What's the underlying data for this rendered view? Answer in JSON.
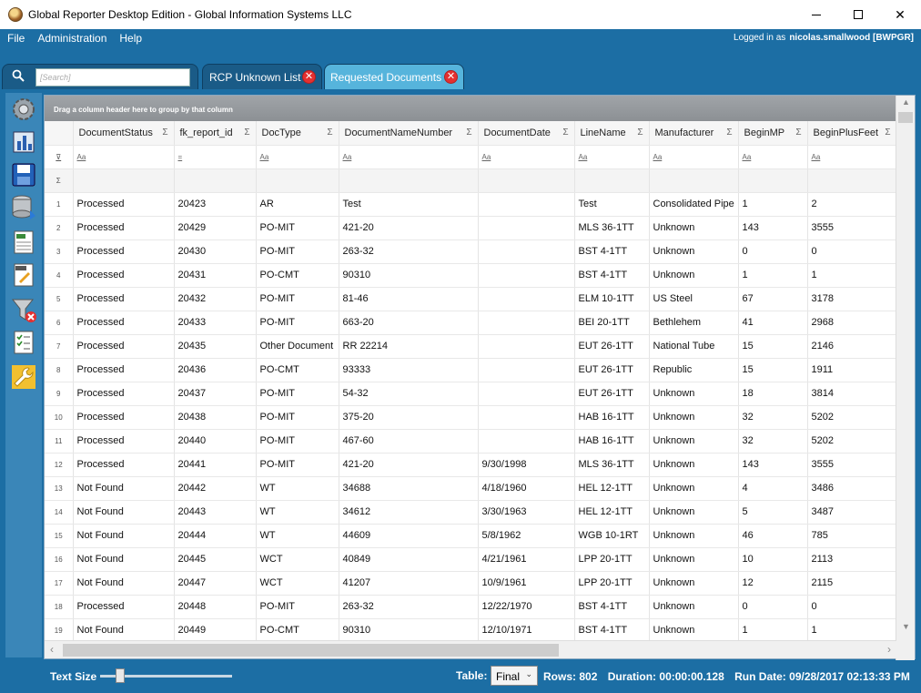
{
  "window": {
    "title": "Global Reporter Desktop Edition - Global Information Systems LLC"
  },
  "menu": {
    "items": [
      "File",
      "Administration",
      "Help"
    ],
    "logged_in_label": "Logged in as",
    "user": "nicolas.smallwood [BWPGR]"
  },
  "tabs": {
    "search_placeholder": "[Search]",
    "items": [
      {
        "label": "RCP Unknown List"
      },
      {
        "label": "Requested Documents"
      }
    ]
  },
  "grid": {
    "group_hint": "Drag a column header here to group by that column",
    "columns": [
      "DocumentStatus",
      "fk_report_id",
      "DocType",
      "DocumentNameNumber",
      "DocumentDate",
      "LineName",
      "Manufacturer",
      "BeginMP",
      "BeginPlusFeet"
    ],
    "filter_ops": [
      "Aa",
      "=",
      "Aa",
      "Aa",
      "Aa",
      "Aa",
      "Aa",
      "Aa",
      "Aa"
    ],
    "rows": [
      [
        "1",
        "Processed",
        "20423",
        "AR",
        "Test",
        "",
        "Test",
        "Consolidated Pipe",
        "1",
        "2"
      ],
      [
        "2",
        "Processed",
        "20429",
        "PO-MIT",
        "421-20",
        "",
        "MLS 36-1TT",
        "Unknown",
        "143",
        "3555"
      ],
      [
        "3",
        "Processed",
        "20430",
        "PO-MIT",
        "263-32",
        "",
        "BST 4-1TT",
        "Unknown",
        "0",
        "0"
      ],
      [
        "4",
        "Processed",
        "20431",
        "PO-CMT",
        "90310",
        "",
        "BST 4-1TT",
        "Unknown",
        "1",
        "1"
      ],
      [
        "5",
        "Processed",
        "20432",
        "PO-MIT",
        "81-46",
        "",
        "ELM 10-1TT",
        "US Steel",
        "67",
        "3178"
      ],
      [
        "6",
        "Processed",
        "20433",
        "PO-MIT",
        "663-20",
        "",
        "BEI 20-1TT",
        "Bethlehem",
        "41",
        "2968"
      ],
      [
        "7",
        "Processed",
        "20435",
        "Other Document",
        "RR 22214",
        "",
        "EUT 26-1TT",
        "National Tube",
        "15",
        "2146"
      ],
      [
        "8",
        "Processed",
        "20436",
        "PO-CMT",
        "93333",
        "",
        "EUT 26-1TT",
        "Republic",
        "15",
        "1911"
      ],
      [
        "9",
        "Processed",
        "20437",
        "PO-MIT",
        "54-32",
        "",
        "EUT 26-1TT",
        "Unknown",
        "18",
        "3814"
      ],
      [
        "10",
        "Processed",
        "20438",
        "PO-MIT",
        "375-20",
        "",
        "HAB 16-1TT",
        "Unknown",
        "32",
        "5202"
      ],
      [
        "11",
        "Processed",
        "20440",
        "PO-MIT",
        "467-60",
        "",
        "HAB 16-1TT",
        "Unknown",
        "32",
        "5202"
      ],
      [
        "12",
        "Processed",
        "20441",
        "PO-MIT",
        "421-20",
        "9/30/1998",
        "MLS 36-1TT",
        "Unknown",
        "143",
        "3555"
      ],
      [
        "13",
        "Not Found",
        "20442",
        "WT",
        "34688",
        "4/18/1960",
        "HEL 12-1TT",
        "Unknown",
        "4",
        "3486"
      ],
      [
        "14",
        "Not Found",
        "20443",
        "WT",
        "34612",
        "3/30/1963",
        "HEL 12-1TT",
        "Unknown",
        "5",
        "3487"
      ],
      [
        "15",
        "Not Found",
        "20444",
        "WT",
        "44609",
        "5/8/1962",
        "WGB 10-1RT",
        "Unknown",
        "46",
        "785"
      ],
      [
        "16",
        "Not Found",
        "20445",
        "WCT",
        "40849",
        "4/21/1961",
        "LPP 20-1TT",
        "Unknown",
        "10",
        "2113"
      ],
      [
        "17",
        "Not Found",
        "20447",
        "WCT",
        "41207",
        "10/9/1961",
        "LPP 20-1TT",
        "Unknown",
        "12",
        "2115"
      ],
      [
        "18",
        "Processed",
        "20448",
        "PO-MIT",
        "263-32",
        "12/22/1970",
        "BST 4-1TT",
        "Unknown",
        "0",
        "0"
      ],
      [
        "19",
        "Not Found",
        "20449",
        "PO-CMT",
        "90310",
        "12/10/1971",
        "BST 4-1TT",
        "Unknown",
        "1",
        "1"
      ]
    ]
  },
  "status": {
    "text_size_label": "Text Size",
    "text_size_level": 0.12,
    "table_label": "Table:",
    "table_value": "Final",
    "rows_label": "Rows:",
    "rows_value": "802",
    "duration_label": "Duration:",
    "duration_value": "00:00:00.128",
    "run_date_label": "Run Date:",
    "run_date_value": "09/28/2017 02:13:33 PM"
  },
  "colors": {
    "accent": "#1c6ea4",
    "active_tab": "#56b4dc",
    "close": "#e53030"
  }
}
